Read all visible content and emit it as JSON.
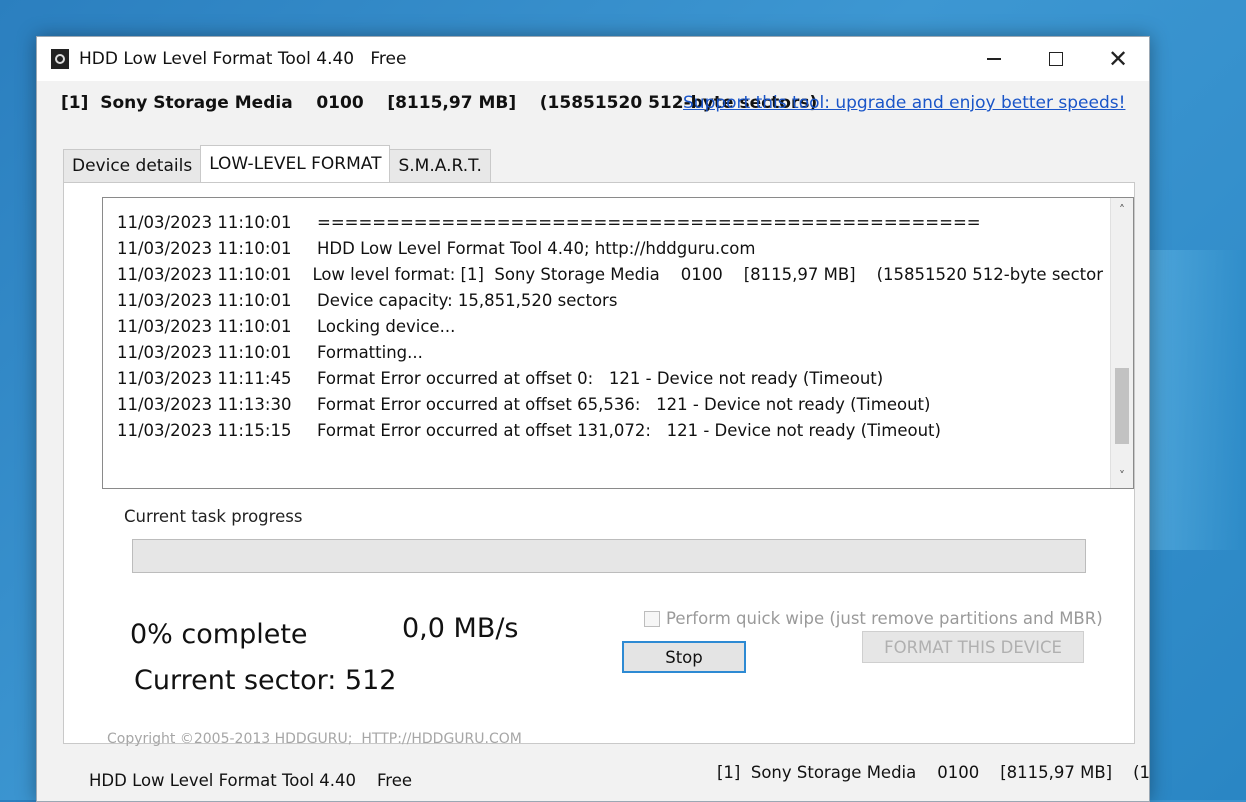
{
  "window": {
    "title": "HDD Low Level Format Tool 4.40",
    "edition": "Free",
    "controls": {
      "minimize": "—",
      "maximize": "☐",
      "close": "✕"
    }
  },
  "device_bar": {
    "text": "[1]  Sony Storage Media    0100    [8115,97 MB]    (15851520 512-byte sectors)",
    "support_link": "Support this tool: upgrade and enjoy better speeds!"
  },
  "tabs": [
    {
      "label": "Device details",
      "active": false
    },
    {
      "label": "LOW-LEVEL FORMAT",
      "active": true
    },
    {
      "label": "S.M.A.R.T.",
      "active": false
    }
  ],
  "log": [
    {
      "time": "11/03/2023 11:10:01",
      "message": "================================================"
    },
    {
      "time": "11/03/2023 11:10:01",
      "message": "HDD Low Level Format Tool 4.40; http://hddguru.com"
    },
    {
      "time": "11/03/2023 11:10:01",
      "message": "Low level format: [1]  Sony Storage Media    0100    [8115,97 MB]    (15851520 512-byte sector"
    },
    {
      "time": "11/03/2023 11:10:01",
      "message": "Device capacity: 15,851,520 sectors"
    },
    {
      "time": "11/03/2023 11:10:01",
      "message": "Locking device..."
    },
    {
      "time": "11/03/2023 11:10:01",
      "message": "Formatting..."
    },
    {
      "time": "11/03/2023 11:11:45",
      "message": "Format Error occurred at offset 0:   121 - Device not ready (Timeout)"
    },
    {
      "time": "11/03/2023 11:13:30",
      "message": "Format Error occurred at offset 65,536:   121 - Device not ready (Timeout)"
    },
    {
      "time": "11/03/2023 11:15:15",
      "message": "Format Error occurred at offset 131,072:   121 - Device not ready (Timeout)"
    }
  ],
  "scroll": {
    "up": "˄",
    "down": "˅"
  },
  "progress": {
    "label": "Current task progress",
    "fraction": 0.0,
    "percent_text": "0% complete",
    "speed_text": "0,0 MB/s",
    "sector_text": "Current sector: 512"
  },
  "options": {
    "quick_wipe_label": "Perform quick wipe (just remove partitions and MBR)",
    "quick_wipe_checked": false
  },
  "buttons": {
    "stop": "Stop",
    "format": "FORMAT THIS DEVICE"
  },
  "footer": {
    "copyright": "Copyright ©2005-2013 HDDGURU;  HTTP://HDDGURU.COM",
    "status_left": "HDD Low Level Format Tool 4.40    Free",
    "status_right": "[1]  Sony Storage Media    0100    [8115,97 MB]    (1"
  },
  "colors": {
    "accent": "#2d8ad3",
    "link": "#1a55c8",
    "progress_fill": "#06b025"
  }
}
